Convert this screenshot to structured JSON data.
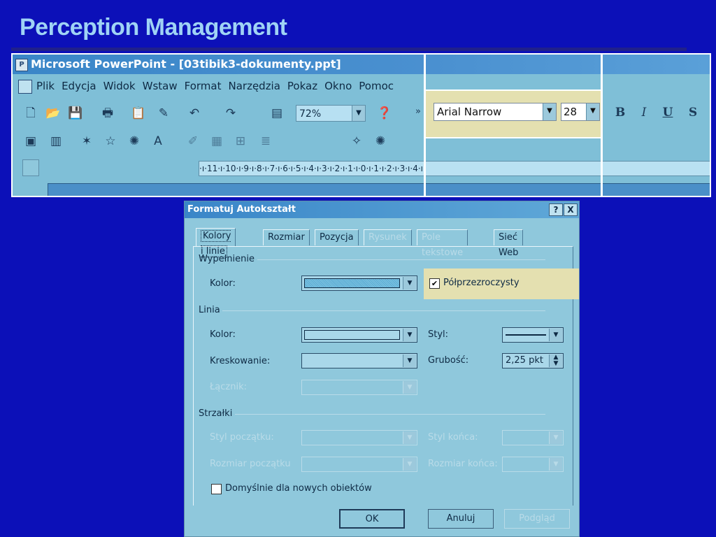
{
  "slide": {
    "title": "Perception Management"
  },
  "ppt_window": {
    "title": "Microsoft PowerPoint - [03tibik3-dokumenty.ppt]",
    "menu": [
      "Plik",
      "Edycja",
      "Widok",
      "Wstaw",
      "Format",
      "Narzędzia",
      "Pokaz",
      "Okno",
      "Pomoc"
    ],
    "zoom": "72%",
    "font_name": "Arial Narrow",
    "font_size": "28",
    "format_buttons": {
      "bold": "B",
      "italic": "I",
      "underline": "U",
      "shadow": "S"
    },
    "ruler_text": "·ı·11·ı·10·ı·9·ı·8·ı·7·ı·6·ı·5·ı·4·ı·3·ı·2·ı·1·ı·0·ı·1·ı·2·ı·3·ı·4·ı"
  },
  "dialog": {
    "title": "Formatuj Autokształt",
    "help_button": "?",
    "close_button": "X",
    "tabs": [
      {
        "label": "Kolory i linie",
        "active": true,
        "enabled": true
      },
      {
        "label": "Rozmiar",
        "enabled": true
      },
      {
        "label": "Pozycja",
        "enabled": true
      },
      {
        "label": "Rysunek",
        "enabled": false
      },
      {
        "label": "Pole tekstowe",
        "enabled": false
      },
      {
        "label": "Sieć Web",
        "enabled": true
      }
    ],
    "fill": {
      "section": "Wypełnienie",
      "color_label": "Kolor:",
      "semitransparent_label": "Półprzezroczysty",
      "semitransparent_checked": "✔"
    },
    "line": {
      "section": "Linia",
      "color_label": "Kolor:",
      "dash_label": "Kreskowanie:",
      "connector_label": "Łącznik:",
      "style_label": "Styl:",
      "weight_label": "Grubość:",
      "weight_value": "2,25 pkt"
    },
    "arrows": {
      "section": "Strzałki",
      "begin_style": "Styl początku:",
      "begin_size": "Rozmiar początku",
      "end_style": "Styl końca:",
      "end_size": "Rozmiar końca:"
    },
    "default_for_new": "Domyślnie dla nowych obiektów",
    "buttons": {
      "ok": "OK",
      "cancel": "Anuluj",
      "preview": "Podgląd"
    }
  }
}
